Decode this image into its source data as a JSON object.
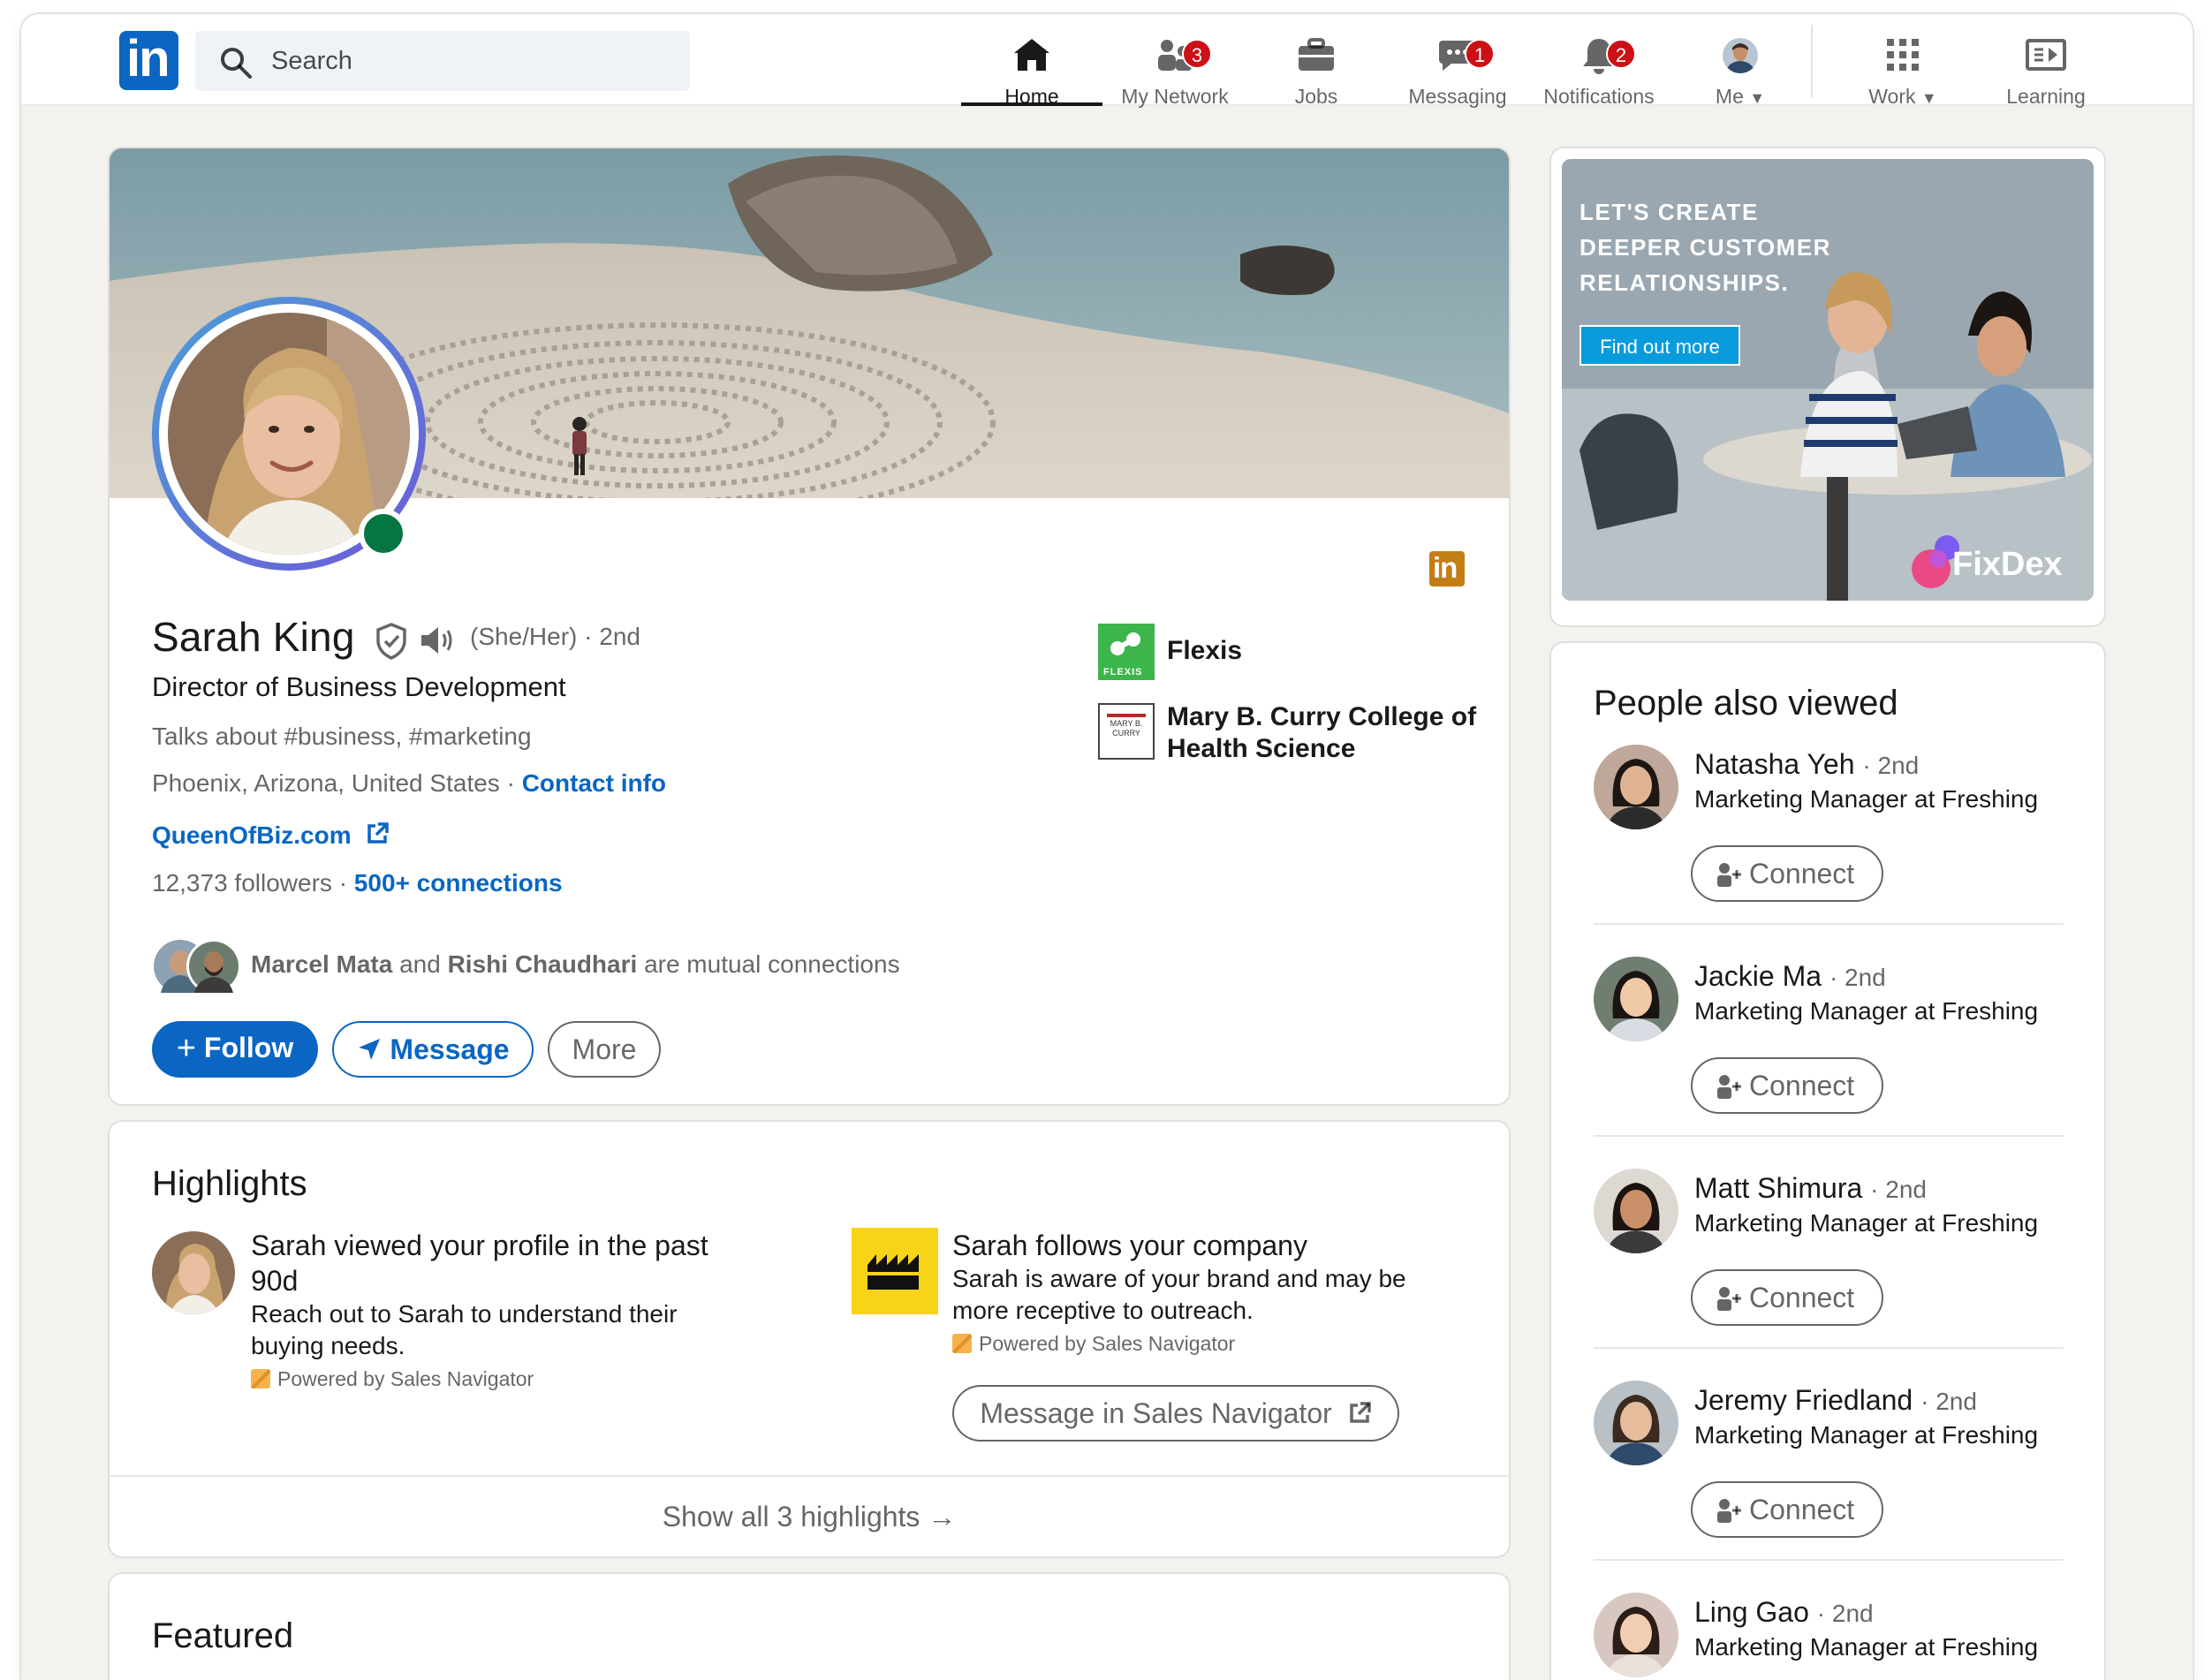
{
  "colors": {
    "brand": "#0a66c2",
    "background": "#f3f2ef",
    "online": "#057642",
    "badge": "#cc1016",
    "ad_button": "#0a9bdc",
    "flexis_green": "#3cb54a",
    "company_yellow": "#f7d417"
  },
  "topnav": {
    "logo_text": "in",
    "search_placeholder": "Search",
    "items": [
      {
        "label": "Home",
        "icon": "home-icon",
        "badge": ""
      },
      {
        "label": "My Network",
        "icon": "people-icon",
        "badge": "3"
      },
      {
        "label": "Jobs",
        "icon": "briefcase-icon",
        "badge": ""
      },
      {
        "label": "Messaging",
        "icon": "chat-icon",
        "badge": "1"
      },
      {
        "label": "Notifications",
        "icon": "bell-icon",
        "badge": "2"
      },
      {
        "label": "Me",
        "icon": "avatar-icon",
        "badge": ""
      },
      {
        "label": "Work",
        "icon": "grid-icon",
        "badge": ""
      },
      {
        "label": "Learning",
        "icon": "learning-icon",
        "badge": ""
      }
    ]
  },
  "profile": {
    "name": "Sarah King",
    "pronouns": "(She/Her)",
    "degree": "· 2nd",
    "headline": "Director of Business Development",
    "talks_about": "Talks about #business, #marketing",
    "location": "Phoenix, Arizona, United States",
    "location_sep": "·",
    "contact_info": "Contact info",
    "website": "QueenOfBiz.com",
    "followers": "12,373 followers",
    "followers_sep": "·",
    "connections": "500+ connections",
    "mutual": {
      "name1": "Marcel Mata",
      "joiner": "and",
      "name2": "Rishi Chaudhari",
      "suffix": "are mutual connections"
    },
    "buttons": {
      "follow": "Follow",
      "message": "Message",
      "more": "More"
    },
    "companies": [
      {
        "name": "Flexis",
        "logo_text": "FLEXIS"
      },
      {
        "name_line1": "Mary B. Curry College of",
        "name_line2": "Health Science",
        "logo_text1": "MARY B.",
        "logo_text2": "CURRY"
      }
    ]
  },
  "highlights": {
    "title": "Highlights",
    "items": [
      {
        "title_line1": "Sarah viewed your profile in the past",
        "title_line2": "90d",
        "body_line1": "Reach out to Sarah to understand their",
        "body_line2": "buying needs.",
        "powered": "Powered by Sales Navigator"
      },
      {
        "title_line1": "Sarah follows your company",
        "body_line1": "Sarah is aware of your brand and may be",
        "body_line2": "more receptive to outreach.",
        "powered": "Powered by Sales Navigator",
        "button": "Message in Sales Navigator"
      }
    ],
    "show_all": "Show all 3 highlights"
  },
  "featured": {
    "title": "Featured"
  },
  "ad": {
    "line1": "LET'S CREATE",
    "line2": "DEEPER CUSTOMER",
    "line3": "RELATIONSHIPS.",
    "button": "Find out more",
    "brand": "FixDex"
  },
  "people_also_viewed": {
    "title": "People also viewed",
    "connect_label": "Connect",
    "people": [
      {
        "name": "Natasha Yeh",
        "degree": "· 2nd",
        "headline": "Marketing Manager at Freshing"
      },
      {
        "name": "Jackie Ma",
        "degree": "· 2nd",
        "headline": "Marketing Manager at Freshing"
      },
      {
        "name": "Matt Shimura",
        "degree": "· 2nd",
        "headline": "Marketing Manager at Freshing"
      },
      {
        "name": "Jeremy Friedland",
        "degree": "· 2nd",
        "headline": "Marketing Manager at Freshing"
      },
      {
        "name": "Ling Gao",
        "degree": "· 2nd",
        "headline": "Marketing Manager at Freshing"
      }
    ]
  }
}
